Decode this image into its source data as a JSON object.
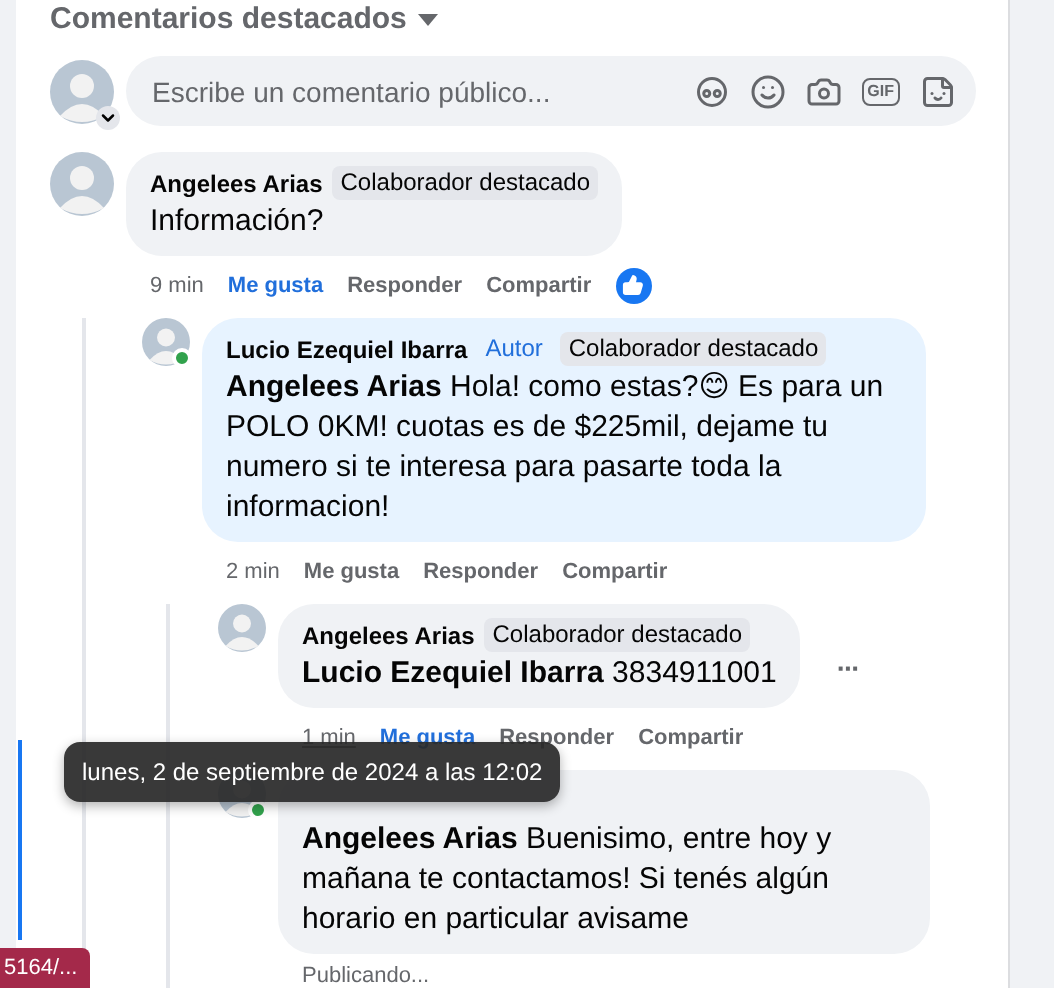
{
  "header": {
    "title": "Comentarios destacados"
  },
  "composer": {
    "placeholder": "Escribe un comentario público...",
    "tools": [
      {
        "kind": "avatar-sticker"
      },
      {
        "kind": "emoji"
      },
      {
        "kind": "camera"
      },
      {
        "kind": "gif",
        "label": "GIF"
      },
      {
        "kind": "sticker"
      }
    ]
  },
  "comments": [
    {
      "author": "Angelees Arias",
      "badges": [
        {
          "label": "Colaborador destacado",
          "kind": "featured"
        }
      ],
      "text": "Información?",
      "time": "9 min",
      "actions": [
        {
          "label": "Me gusta",
          "selected": true
        },
        {
          "label": "Responder",
          "selected": false
        },
        {
          "label": "Compartir",
          "selected": false
        }
      ],
      "liked": true,
      "children": [
        {
          "author": "Lucio Ezequiel Ibarra",
          "online": true,
          "badges": [
            {
              "label": "Autor",
              "kind": "author"
            },
            {
              "label": "Colaborador destacado",
              "kind": "featured"
            }
          ],
          "text": "**Angelees Arias** Hola! como estas?😊 Es para un POLO 0KM! cuotas es de $225mil, dejame tu numero si te interesa para pasarte toda la informacion!",
          "time": "2 min",
          "actions": [
            {
              "label": "Me gusta",
              "selected": false
            },
            {
              "label": "Responder",
              "selected": false
            },
            {
              "label": "Compartir",
              "selected": false
            }
          ],
          "children": [
            {
              "author": "Angelees Arias",
              "badges": [
                {
                  "label": "Colaborador destacado",
                  "kind": "featured"
                }
              ],
              "text": "**Lucio Ezequiel Ibarra** 3834911001",
              "time": "1 min",
              "time_hovered": true,
              "actions": [
                {
                  "label": "Me gusta",
                  "selected": true
                },
                {
                  "label": "Responder",
                  "selected": false
                },
                {
                  "label": "Compartir",
                  "selected": false
                }
              ],
              "more_label": "···"
            },
            {
              "online": true,
              "text": "**Angelees Arias** Buenisimo, entre hoy y mañana te contactamos! Si tenés algún horario en particular avisame",
              "status": "Publicando..."
            }
          ]
        }
      ]
    }
  ],
  "tooltip": {
    "text": "lunes, 2 de septiembre de 2024 a las 12:02"
  },
  "status_url": {
    "text": "5164/..."
  }
}
